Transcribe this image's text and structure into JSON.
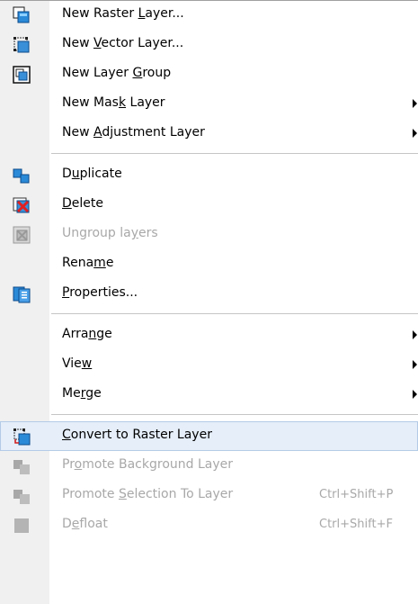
{
  "menu": {
    "items": [
      {
        "pre": "New Raster ",
        "key": "L",
        "post": "ayer...",
        "icon": "new-raster-layer-icon"
      },
      {
        "pre": "New ",
        "key": "V",
        "post": "ector Layer...",
        "icon": "new-vector-layer-icon"
      },
      {
        "pre": "New Layer ",
        "key": "G",
        "post": "roup",
        "icon": "new-layer-group-icon"
      },
      {
        "pre": "New Mas",
        "key": "k",
        "post": " Layer",
        "submenu": true
      },
      {
        "pre": "New ",
        "key": "A",
        "post": "djustment Layer",
        "submenu": true
      },
      {
        "pre": "D",
        "key": "u",
        "post": "plicate",
        "icon": "duplicate-icon"
      },
      {
        "pre": "",
        "key": "D",
        "post": "elete",
        "icon": "delete-icon"
      },
      {
        "pre": "Ungroup la",
        "key": "y",
        "post": "ers",
        "icon": "ungroup-icon",
        "disabled": true
      },
      {
        "pre": "Rena",
        "key": "m",
        "post": "e"
      },
      {
        "pre": "",
        "key": "P",
        "post": "roperties...",
        "icon": "properties-icon"
      },
      {
        "pre": "Arra",
        "key": "n",
        "post": "ge",
        "submenu": true
      },
      {
        "pre": "Vie",
        "key": "w",
        "post": "",
        "submenu": true
      },
      {
        "pre": "Me",
        "key": "r",
        "post": "ge",
        "submenu": true
      },
      {
        "pre": "",
        "key": "C",
        "post": "onvert to Raster Layer",
        "icon": "convert-to-raster-icon",
        "selected": true
      },
      {
        "pre": "Pr",
        "key": "o",
        "post": "mote Background Layer",
        "icon": "promote-background-icon",
        "disabled": true
      },
      {
        "pre": "Promote ",
        "key": "S",
        "post": "election To Layer",
        "icon": "promote-selection-icon",
        "disabled": true,
        "shortcut": "Ctrl+Shift+P"
      },
      {
        "pre": "D",
        "key": "e",
        "post": "float",
        "icon": "defloat-icon",
        "disabled": true,
        "shortcut": "Ctrl+Shift+F"
      }
    ]
  }
}
